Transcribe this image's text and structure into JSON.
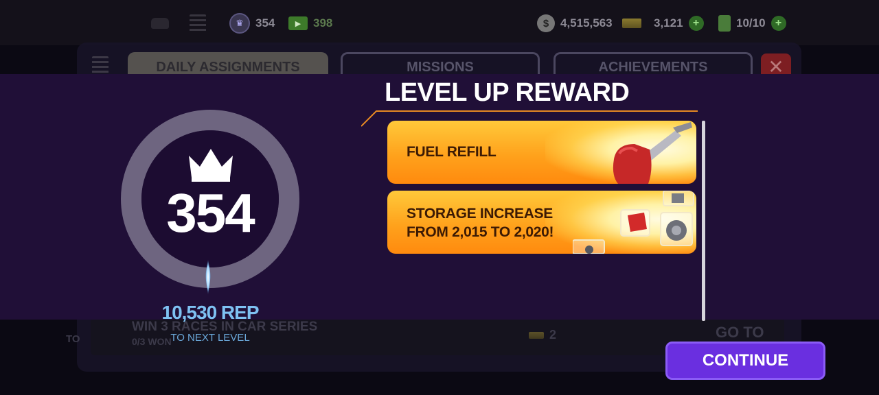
{
  "hud": {
    "rep_level": "354",
    "tickets": "398",
    "cash": "4,515,563",
    "gold": "3,121",
    "fuel": "10/10",
    "cash_symbol": "$"
  },
  "tabs": [
    {
      "label": "DAILY ASSIGNMENTS",
      "active": true
    },
    {
      "label": "MISSIONS",
      "active": false
    },
    {
      "label": "ACHIEVEMENTS",
      "active": false
    }
  ],
  "background_row": {
    "task": "WIN 3 RACES IN CAR SERIES",
    "progress": "0/3 WON",
    "to_label": "TO",
    "reward": "2",
    "goto_label": "GO TO"
  },
  "level": {
    "number": "354",
    "rep_to_next": "10,530 REP",
    "rep_caption": "TO NEXT LEVEL"
  },
  "reward": {
    "title": "LEVEL UP REWARD",
    "items": [
      {
        "line1": "FUEL REFILL",
        "line2": "",
        "icon": "fuel-nozzle-icon"
      },
      {
        "line1": "STORAGE INCREASE",
        "line2": "FROM 2,015 TO 2,020!",
        "icon": "car-parts-icon"
      }
    ]
  },
  "buttons": {
    "continue": "CONTINUE"
  },
  "colors": {
    "overlay": "#200f37",
    "accent_orange": "#ffa21c",
    "rep_blue": "#7ec1f2",
    "button_purple": "#6a2fe0"
  }
}
